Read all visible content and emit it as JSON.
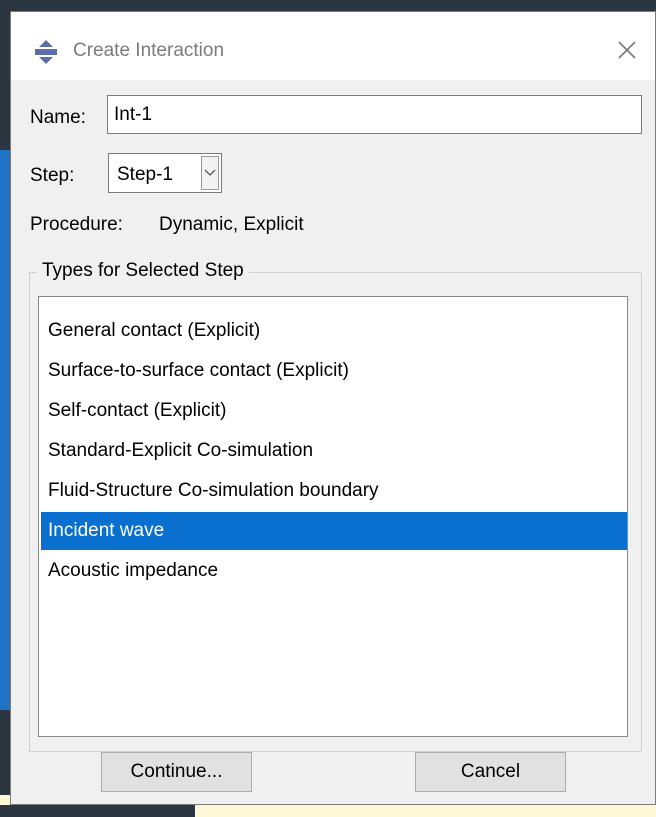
{
  "dialog": {
    "title": "Create Interaction",
    "close_icon": "close-icon",
    "app_icon": "abaqus-interaction-icon"
  },
  "form": {
    "name_label": "Name:",
    "name_value": "Int-1",
    "step_label": "Step:",
    "step_value": "Step-1",
    "procedure_label": "Procedure:",
    "procedure_value": "Dynamic, Explicit"
  },
  "types": {
    "group_label": "Types for Selected Step",
    "items": [
      "General contact (Explicit)",
      "Surface-to-surface contact (Explicit)",
      "Self-contact (Explicit)",
      "Standard-Explicit Co-simulation",
      "Fluid-Structure Co-simulation boundary",
      "Incident wave",
      "Acoustic impedance"
    ],
    "selected_index": 5
  },
  "buttons": {
    "continue_label": "Continue...",
    "cancel_label": "Cancel"
  },
  "colors": {
    "selection": "#0a70d0",
    "dialog_bg": "#f0f0f0",
    "background_accent": "#1f73c7"
  }
}
